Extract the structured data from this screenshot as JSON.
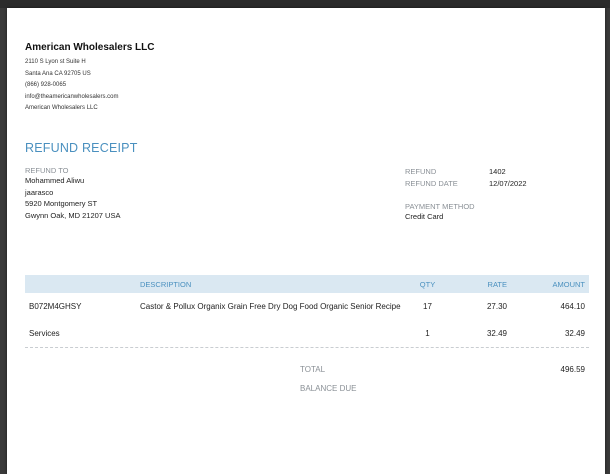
{
  "company": {
    "name": "American Wholesalers LLC",
    "address_line1": "2110 S Lyon st Suite H",
    "address_line2": "Santa Ana CA 92705 US",
    "phone": "(866) 928-0065",
    "email": "info@theamericanwholesalers.com",
    "name_footer": "American Wholesalers LLC"
  },
  "receipt": {
    "title": "REFUND RECEIPT",
    "refund_to_label": "REFUND TO",
    "customer": {
      "name": "Mohammed Aliwu",
      "company": "jaarasco",
      "street": "5920 Montgomery ST",
      "city_line": "Gwynn Oak, MD  21207 USA"
    },
    "refund_label": "REFUND",
    "refund_number": "1402",
    "refund_date_label": "REFUND DATE",
    "refund_date": "12/07/2022",
    "payment_method_label": "PAYMENT METHOD",
    "payment_method": "Credit Card"
  },
  "table": {
    "headers": {
      "code": "",
      "description": "DESCRIPTION",
      "qty": "QTY",
      "rate": "RATE",
      "amount": "AMOUNT"
    },
    "rows": [
      {
        "code": "B072M4GHSY",
        "description": "Castor & Pollux Organix Grain Free Dry Dog Food Organic Senior Recipe",
        "qty": "17",
        "rate": "27.30",
        "amount": "464.10"
      },
      {
        "code": "Services",
        "description": "",
        "qty": "1",
        "rate": "32.49",
        "amount": "32.49"
      }
    ]
  },
  "totals": {
    "total_label": "TOTAL",
    "total_value": "496.59",
    "balance_due_label": "BALANCE DUE",
    "balance_due_value": ""
  },
  "colors": {
    "accent": "#4a90bf",
    "header_bg": "#dae8f2"
  }
}
